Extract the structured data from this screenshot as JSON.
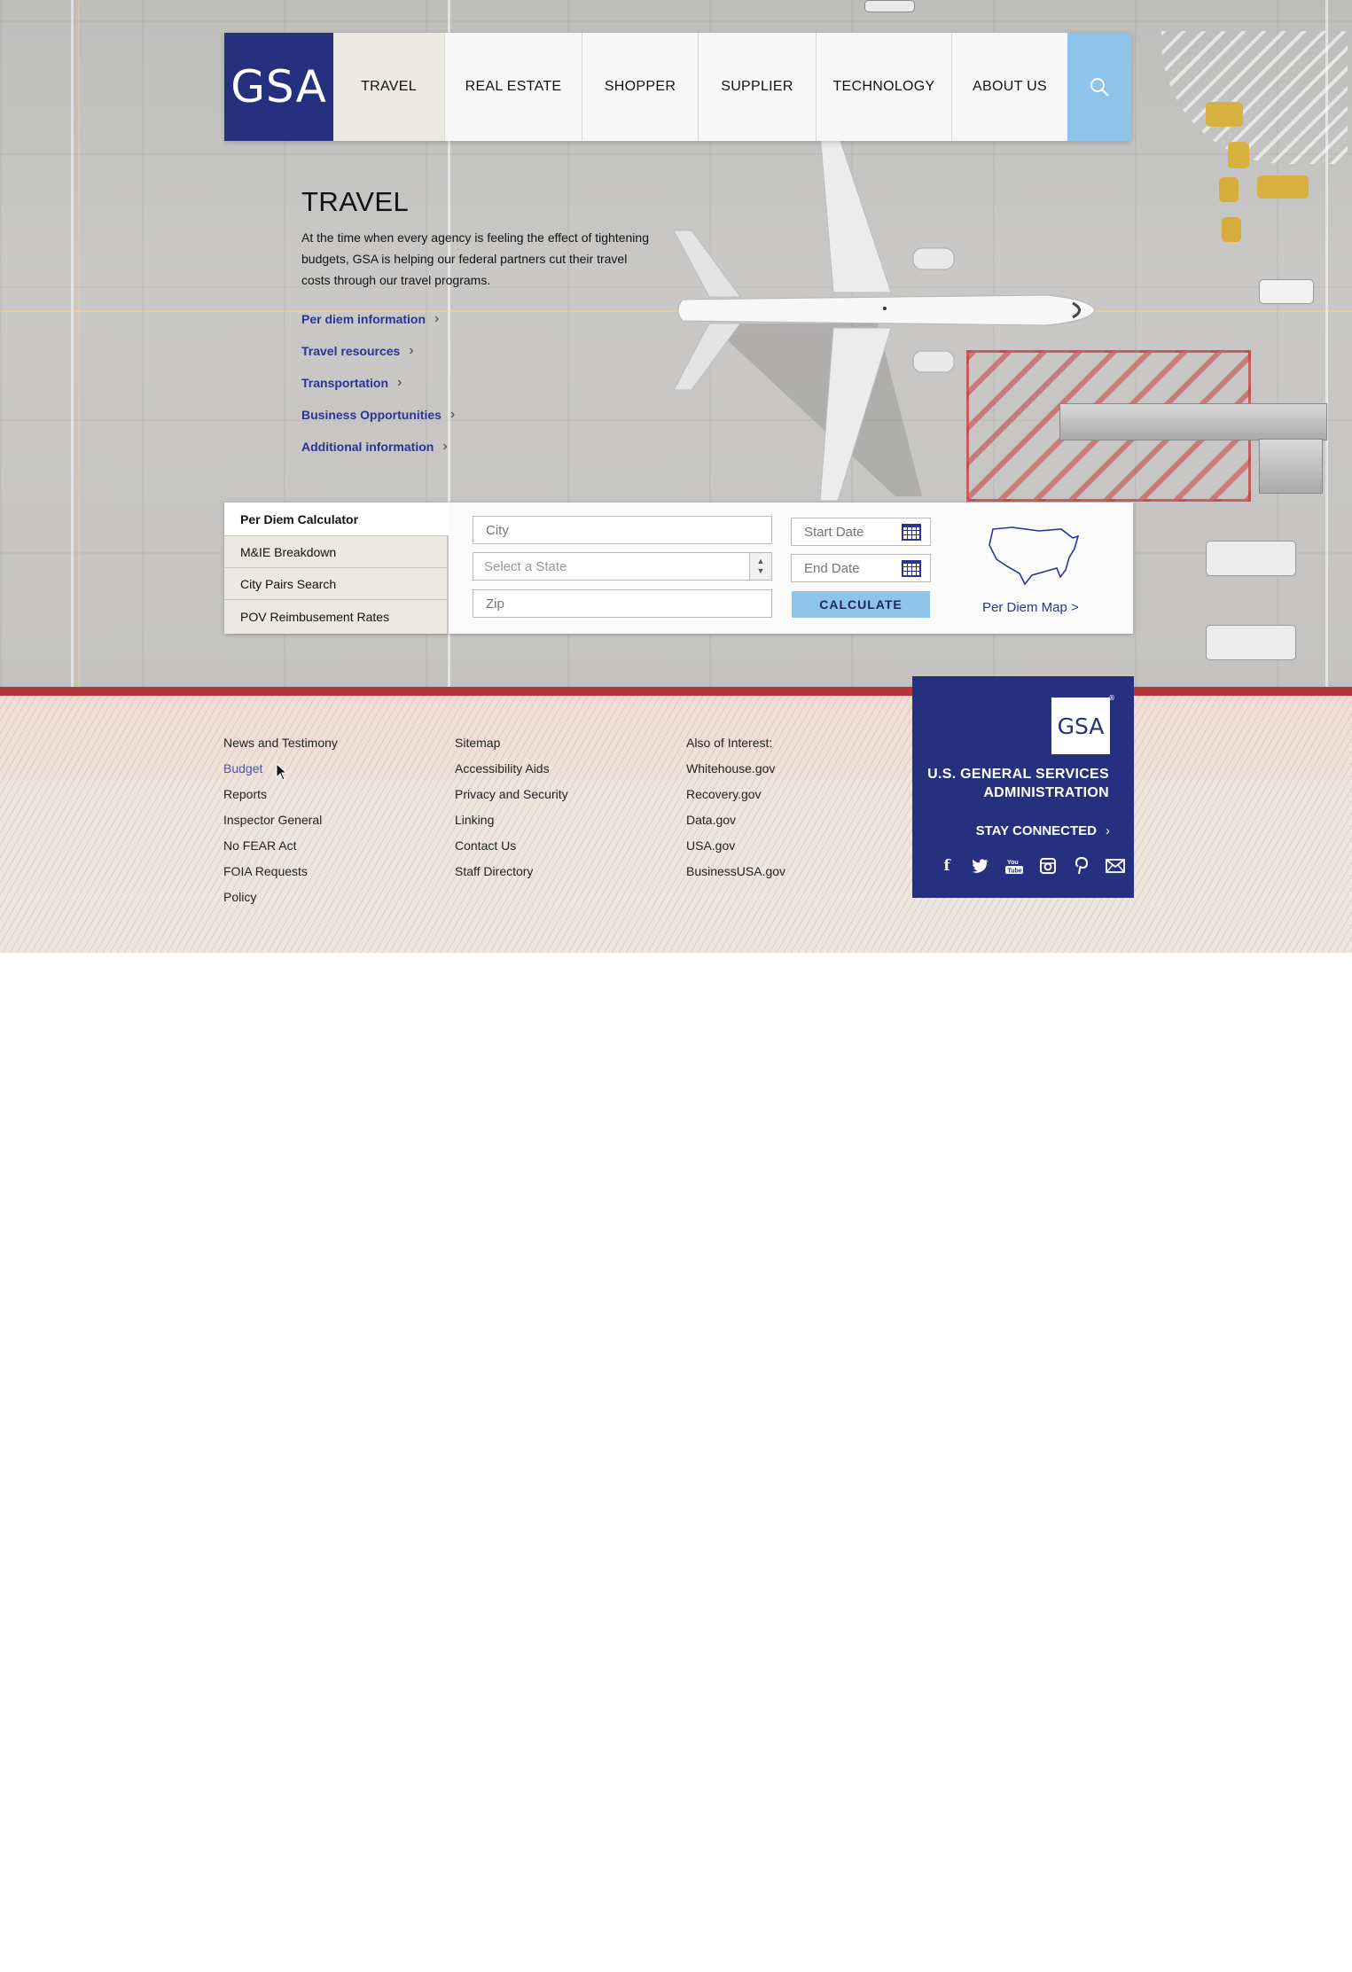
{
  "header": {
    "logo_text": "GSA",
    "nav": [
      {
        "label": "TRAVEL",
        "active": true
      },
      {
        "label": "REAL ESTATE",
        "active": false
      },
      {
        "label": "SHOPPER",
        "active": false
      },
      {
        "label": "SUPPLIER",
        "active": false
      },
      {
        "label": "TECHNOLOGY",
        "active": false
      },
      {
        "label": "ABOUT US",
        "active": false
      }
    ],
    "search_icon": "search-icon"
  },
  "intro": {
    "title": "TRAVEL",
    "description": "At the time when every agency is feeling the effect of tightening budgets, GSA is helping our federal partners cut their travel costs through our travel programs.",
    "links": [
      "Per diem information",
      "Travel resources",
      "Transportation",
      "Business Opportunities",
      "Additional information"
    ]
  },
  "calculator": {
    "tabs": [
      {
        "label": "Per Diem Calculator",
        "active": true
      },
      {
        "label": "M&IE Breakdown",
        "active": false
      },
      {
        "label": "City Pairs Search",
        "active": false
      },
      {
        "label": "POV Reimbusement Rates",
        "active": false
      }
    ],
    "city_placeholder": "City",
    "state_placeholder": "Select a State",
    "zip_placeholder": "Zip",
    "start_date_placeholder": "Start Date",
    "end_date_placeholder": "End Date",
    "calculate_label": "CALCULATE",
    "map_link": "Per Diem Map >"
  },
  "footer": {
    "col1": [
      "News and Testimony",
      "Budget",
      "Reports",
      "Inspector General",
      "No FEAR Act",
      "FOIA Requests",
      "Policy"
    ],
    "col2": [
      "Sitemap",
      "Accessibility Aids",
      "Privacy and Security",
      "Linking",
      "Contact Us",
      "Staff Directory"
    ],
    "col3_heading": "Also of Interest:",
    "col3": [
      "Whitehouse.gov",
      "Recovery.gov",
      "Data.gov",
      "USA.gov",
      "BusinessUSA.gov"
    ],
    "brand": {
      "logo_text": "GSA",
      "name_line1": "U.S. GENERAL SERVICES",
      "name_line2": "ADMINISTRATION",
      "stay_connected": "STAY CONNECTED",
      "socials": [
        "facebook-icon",
        "twitter-icon",
        "youtube-icon",
        "instagram-icon",
        "pinterest-icon",
        "email-icon"
      ]
    }
  },
  "colors": {
    "brand_navy": "#25307e",
    "accent_blue": "#8ec4ea",
    "link_blue": "#2b3590",
    "footer_red": "#b3363a"
  }
}
